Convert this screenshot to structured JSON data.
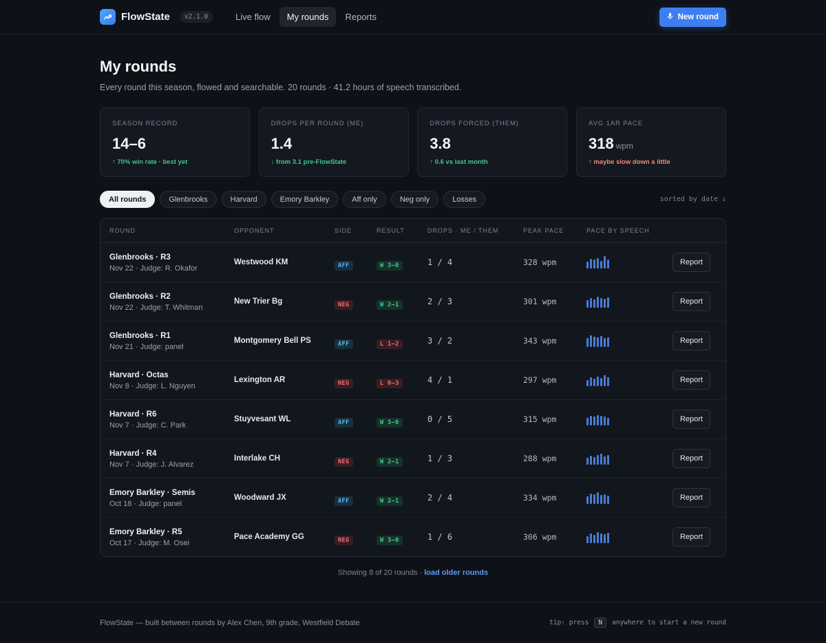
{
  "header": {
    "brand": "FlowState",
    "version": "v2.1.0",
    "nav": [
      {
        "label": "Live flow",
        "active": false
      },
      {
        "label": "My rounds",
        "active": true
      },
      {
        "label": "Reports",
        "active": false
      }
    ],
    "new_round_label": "New round",
    "accent": "#3d7ff0"
  },
  "page": {
    "title": "My rounds",
    "subtitle": "Every round this season, flowed and searchable. 20 rounds · 41.2 hours of speech transcribed."
  },
  "stats": [
    {
      "label": "SEASON RECORD",
      "value": "14–6",
      "unit": "",
      "note": "↑ 70% win rate · best yet",
      "tone": "good"
    },
    {
      "label": "DROPS PER ROUND (ME)",
      "value": "1.4",
      "unit": "",
      "note": "↓ from 3.1 pre-FlowState",
      "tone": "good"
    },
    {
      "label": "DROPS FORCED (THEM)",
      "value": "3.8",
      "unit": "",
      "note": "↑ 0.6 vs last month",
      "tone": "good"
    },
    {
      "label": "AVG 1AR PACE",
      "value": "318",
      "unit": "wpm",
      "note": "↑ maybe slow down a little",
      "tone": "bad"
    }
  ],
  "filters": [
    "All rounds",
    "Glenbrooks",
    "Harvard",
    "Emory Barkley",
    "Aff only",
    "Neg only",
    "Losses"
  ],
  "active_filter": 0,
  "sorted_label": "sorted by date ↓",
  "table": {
    "columns": [
      "ROUND",
      "OPPONENT",
      "SIDE",
      "RESULT",
      "DROPS · ME / THEM",
      "PEAK PACE",
      "PACE BY SPEECH"
    ],
    "report_label": "Report",
    "rows": [
      {
        "round": "Glenbrooks · R3",
        "meta": "Nov 22 · Judge: R. Okafor",
        "opponent": "Westwood KM",
        "side": "AFF",
        "result": "W 3–0",
        "outcome": "win",
        "drops": "1 / 4",
        "pace": "328 wpm",
        "spark": [
          0.55,
          0.75,
          0.7,
          0.85,
          0.6,
          1.0,
          0.7
        ]
      },
      {
        "round": "Glenbrooks · R2",
        "meta": "Nov 22 · Judge: T. Whitman",
        "opponent": "New Trier Bg",
        "side": "NEG",
        "result": "W 2–1",
        "outcome": "win",
        "drops": "2 / 3",
        "pace": "301 wpm",
        "spark": [
          0.6,
          0.8,
          0.65,
          0.9,
          0.75,
          0.7,
          0.85
        ]
      },
      {
        "round": "Glenbrooks · R1",
        "meta": "Nov 21 · Judge: panel",
        "opponent": "Montgomery Bell PS",
        "side": "AFF",
        "result": "L 1–2",
        "outcome": "loss",
        "drops": "3 / 2",
        "pace": "343 wpm",
        "spark": [
          0.7,
          0.95,
          0.85,
          0.75,
          0.9,
          0.7,
          0.8
        ]
      },
      {
        "round": "Harvard · Octas",
        "meta": "Nov 8 · Judge: L. Nguyen",
        "opponent": "Lexington AR",
        "side": "NEG",
        "result": "L 0–3",
        "outcome": "loss",
        "drops": "4 / 1",
        "pace": "297 wpm",
        "spark": [
          0.5,
          0.7,
          0.6,
          0.8,
          0.65,
          0.9,
          0.7
        ]
      },
      {
        "round": "Harvard · R6",
        "meta": "Nov 7 · Judge: C. Park",
        "opponent": "Stuyvesant WL",
        "side": "AFF",
        "result": "W 3–0",
        "outcome": "win",
        "drops": "0 / 5",
        "pace": "315 wpm",
        "spark": [
          0.6,
          0.75,
          0.7,
          0.85,
          0.8,
          0.7,
          0.6
        ]
      },
      {
        "round": "Harvard · R4",
        "meta": "Nov 7 · Judge: J. Alvarez",
        "opponent": "Interlake CH",
        "side": "NEG",
        "result": "W 2–1",
        "outcome": "win",
        "drops": "1 / 3",
        "pace": "288 wpm",
        "spark": [
          0.55,
          0.7,
          0.6,
          0.8,
          0.9,
          0.65,
          0.75
        ]
      },
      {
        "round": "Emory Barkley · Semis",
        "meta": "Oct 18 · Judge: panel",
        "opponent": "Woodward JX",
        "side": "AFF",
        "result": "W 2–1",
        "outcome": "win",
        "drops": "2 / 4",
        "pace": "334 wpm",
        "spark": [
          0.6,
          0.85,
          0.75,
          0.95,
          0.7,
          0.8,
          0.65
        ]
      },
      {
        "round": "Emory Barkley · R5",
        "meta": "Oct 17 · Judge: M. Osei",
        "opponent": "Pace Academy GG",
        "side": "NEG",
        "result": "W 3–0",
        "outcome": "win",
        "drops": "1 / 6",
        "pace": "306 wpm",
        "spark": [
          0.55,
          0.75,
          0.65,
          0.9,
          0.8,
          0.7,
          0.85
        ]
      }
    ]
  },
  "pagination": {
    "text": "Showing 8 of 20 rounds · ",
    "link": "load older rounds"
  },
  "footer": {
    "left": "FlowState — built between rounds by Alex Chen, 9th grade, Westfield Debate",
    "tip_prefix": "tip: press",
    "tip_key": "N",
    "tip_suffix": "anywhere to start a new round"
  }
}
